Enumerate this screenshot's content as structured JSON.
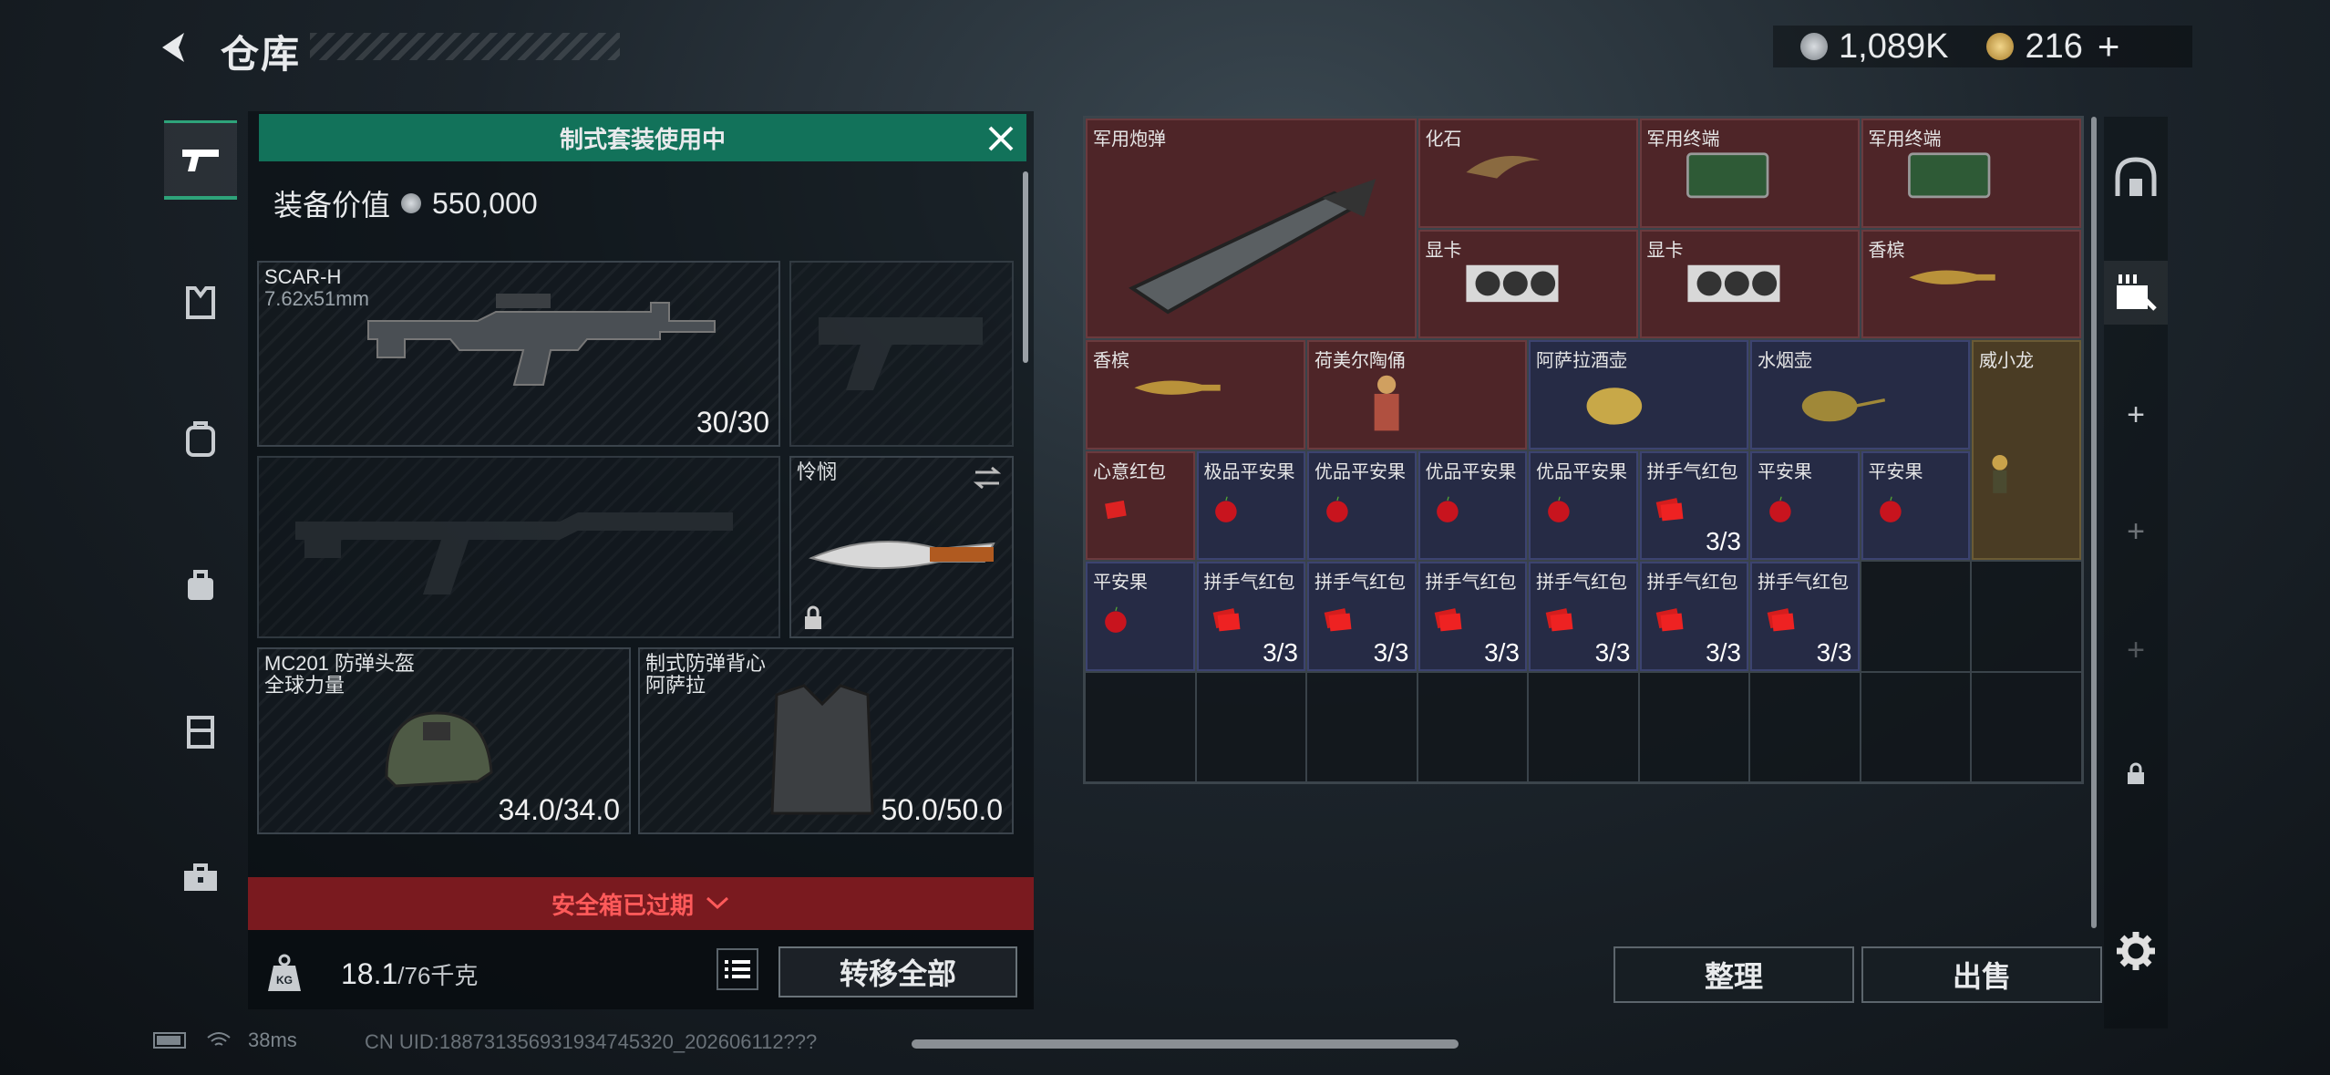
{
  "header": {
    "title": "仓库",
    "currency1": "1,089K",
    "currency2": "216",
    "add_icon": "plus-icon"
  },
  "left_nav": [
    "pistol-icon",
    "vest-icon",
    "backpack-icon",
    "bag-icon",
    "container-icon",
    "toolbox-icon"
  ],
  "equipment": {
    "banner": "制式套装使用中",
    "value_label": "装备价值",
    "value": "550,000",
    "primary": {
      "name": "SCAR-H",
      "caliber": "7.62x51mm",
      "ammo": "30/30"
    },
    "knife": {
      "name": "怜悯"
    },
    "helmet": {
      "name": "MC201 防弹头盔",
      "sub": "全球力量",
      "durability": "34.0/34.0"
    },
    "armor": {
      "name": "制式防弹背心",
      "sub": "阿萨拉",
      "durability": "50.0/50.0"
    },
    "expired": "安全箱已过期",
    "weight": "18.1",
    "weight_max": "/76千克",
    "transfer_all": "转移全部",
    "kg_icon": "KG"
  },
  "storage": {
    "items": [
      {
        "name": "军用炮弹",
        "color": "red",
        "count": ""
      },
      {
        "name": "化石",
        "color": "red",
        "count": ""
      },
      {
        "name": "军用终端",
        "color": "red",
        "count": ""
      },
      {
        "name": "军用终端",
        "color": "red",
        "count": ""
      },
      {
        "name": "显卡",
        "color": "red",
        "count": ""
      },
      {
        "name": "显卡",
        "color": "red",
        "count": ""
      },
      {
        "name": "香槟",
        "color": "red",
        "count": ""
      },
      {
        "name": "香槟",
        "color": "red",
        "count": ""
      },
      {
        "name": "荷美尔陶俑",
        "color": "red",
        "count": ""
      },
      {
        "name": "阿萨拉酒壶",
        "color": "blue",
        "count": ""
      },
      {
        "name": "水烟壶",
        "color": "blue",
        "count": ""
      },
      {
        "name": "威小龙",
        "color": "gold",
        "count": ""
      },
      {
        "name": "心意红包",
        "color": "red",
        "count": ""
      },
      {
        "name": "极品平安果",
        "color": "blue",
        "count": ""
      },
      {
        "name": "优品平安果",
        "color": "blue",
        "count": ""
      },
      {
        "name": "优品平安果",
        "color": "blue",
        "count": ""
      },
      {
        "name": "优品平安果",
        "color": "blue",
        "count": ""
      },
      {
        "name": "拼手气红包",
        "color": "blue",
        "count": "3/3"
      },
      {
        "name": "平安果",
        "color": "blue",
        "count": ""
      },
      {
        "name": "平安果",
        "color": "blue",
        "count": ""
      },
      {
        "name": "平安果",
        "color": "blue",
        "count": ""
      },
      {
        "name": "拼手气红包",
        "color": "blue",
        "count": "3/3"
      },
      {
        "name": "拼手气红包",
        "color": "blue",
        "count": "3/3"
      },
      {
        "name": "拼手气红包",
        "color": "blue",
        "count": "3/3"
      },
      {
        "name": "拼手气红包",
        "color": "blue",
        "count": "3/3"
      },
      {
        "name": "拼手气红包",
        "color": "blue",
        "count": "3/3"
      },
      {
        "name": "拼手气红包",
        "color": "blue",
        "count": "3/3"
      }
    ],
    "sort": "整理",
    "sell": "出售"
  },
  "right_nav": [
    "base-icon",
    "gun-workbench-icon",
    "plus-icon",
    "plus-icon",
    "plus-icon",
    "lock-icon"
  ],
  "status": {
    "ping": "38ms",
    "uid": "CN UID:18873135693193474532​0_20260611​2???"
  },
  "colors": {
    "red": "#4e2528",
    "blue": "#262b45",
    "gold": "#4a3c24",
    "accent": "#12725a"
  }
}
